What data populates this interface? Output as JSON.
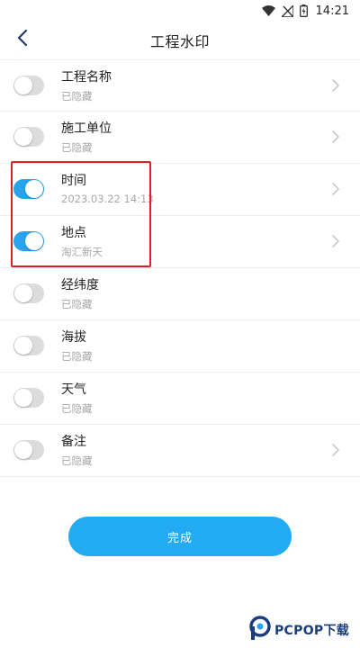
{
  "status_bar": {
    "time": "14:21",
    "icons": [
      "wifi-icon",
      "no-signal-icon",
      "battery-icon"
    ]
  },
  "header": {
    "title": "工程水印",
    "back_icon": "chevron-left-icon"
  },
  "colors": {
    "accent": "#29a3ee",
    "button": "#22aaf3",
    "toggle_off": "#dcdcdc",
    "highlight": "#e02020"
  },
  "items": [
    {
      "title": "工程名称",
      "subtitle": "已隐藏",
      "enabled": false,
      "has_chevron": true
    },
    {
      "title": "施工单位",
      "subtitle": "已隐藏",
      "enabled": false,
      "has_chevron": true
    },
    {
      "title": "时间",
      "subtitle": "2023.03.22 14:13",
      "enabled": true,
      "has_chevron": true
    },
    {
      "title": "地点",
      "subtitle": "淘汇新天",
      "enabled": true,
      "has_chevron": true
    },
    {
      "title": "经纬度",
      "subtitle": "已隐藏",
      "enabled": false,
      "has_chevron": false
    },
    {
      "title": "海拔",
      "subtitle": "已隐藏",
      "enabled": false,
      "has_chevron": false
    },
    {
      "title": "天气",
      "subtitle": "已隐藏",
      "enabled": false,
      "has_chevron": false
    },
    {
      "title": "备注",
      "subtitle": "已隐藏",
      "enabled": false,
      "has_chevron": true
    }
  ],
  "done_button": {
    "label": "完成"
  },
  "watermark": {
    "text": "PCPOP下载",
    "logo_icon": "pcpop-logo-icon"
  }
}
